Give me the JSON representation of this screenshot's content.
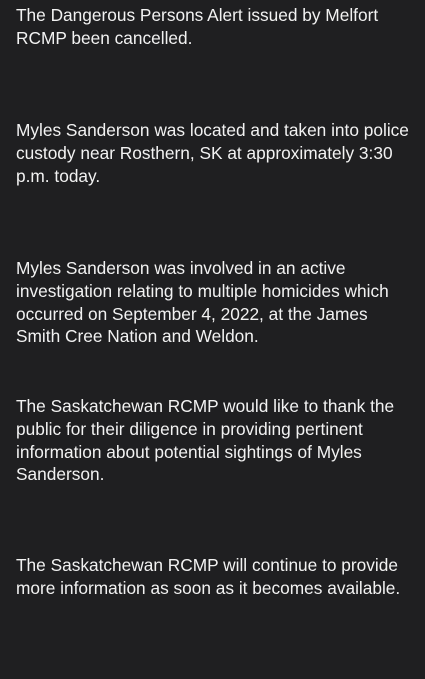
{
  "message": {
    "paragraphs": [
      "The Dangerous Persons Alert issued by Melfort RCMP been cancelled.",
      "Myles Sanderson was located and taken into police custody near Rosthern, SK at approximately 3:30 p.m. today.",
      "Myles Sanderson was involved in an active investigation relating to multiple homicides which occurred on September 4, 2022, at the James Smith Cree Nation and Weldon.",
      "The Saskatchewan RCMP would like to thank the public for their diligence in providing pertinent information about potential sightings of Myles Sanderson.",
      "The Saskatchewan RCMP will continue to provide more information as soon as it becomes available."
    ]
  },
  "colors": {
    "background": "#1f1f21",
    "text": "#f2f2f2"
  }
}
